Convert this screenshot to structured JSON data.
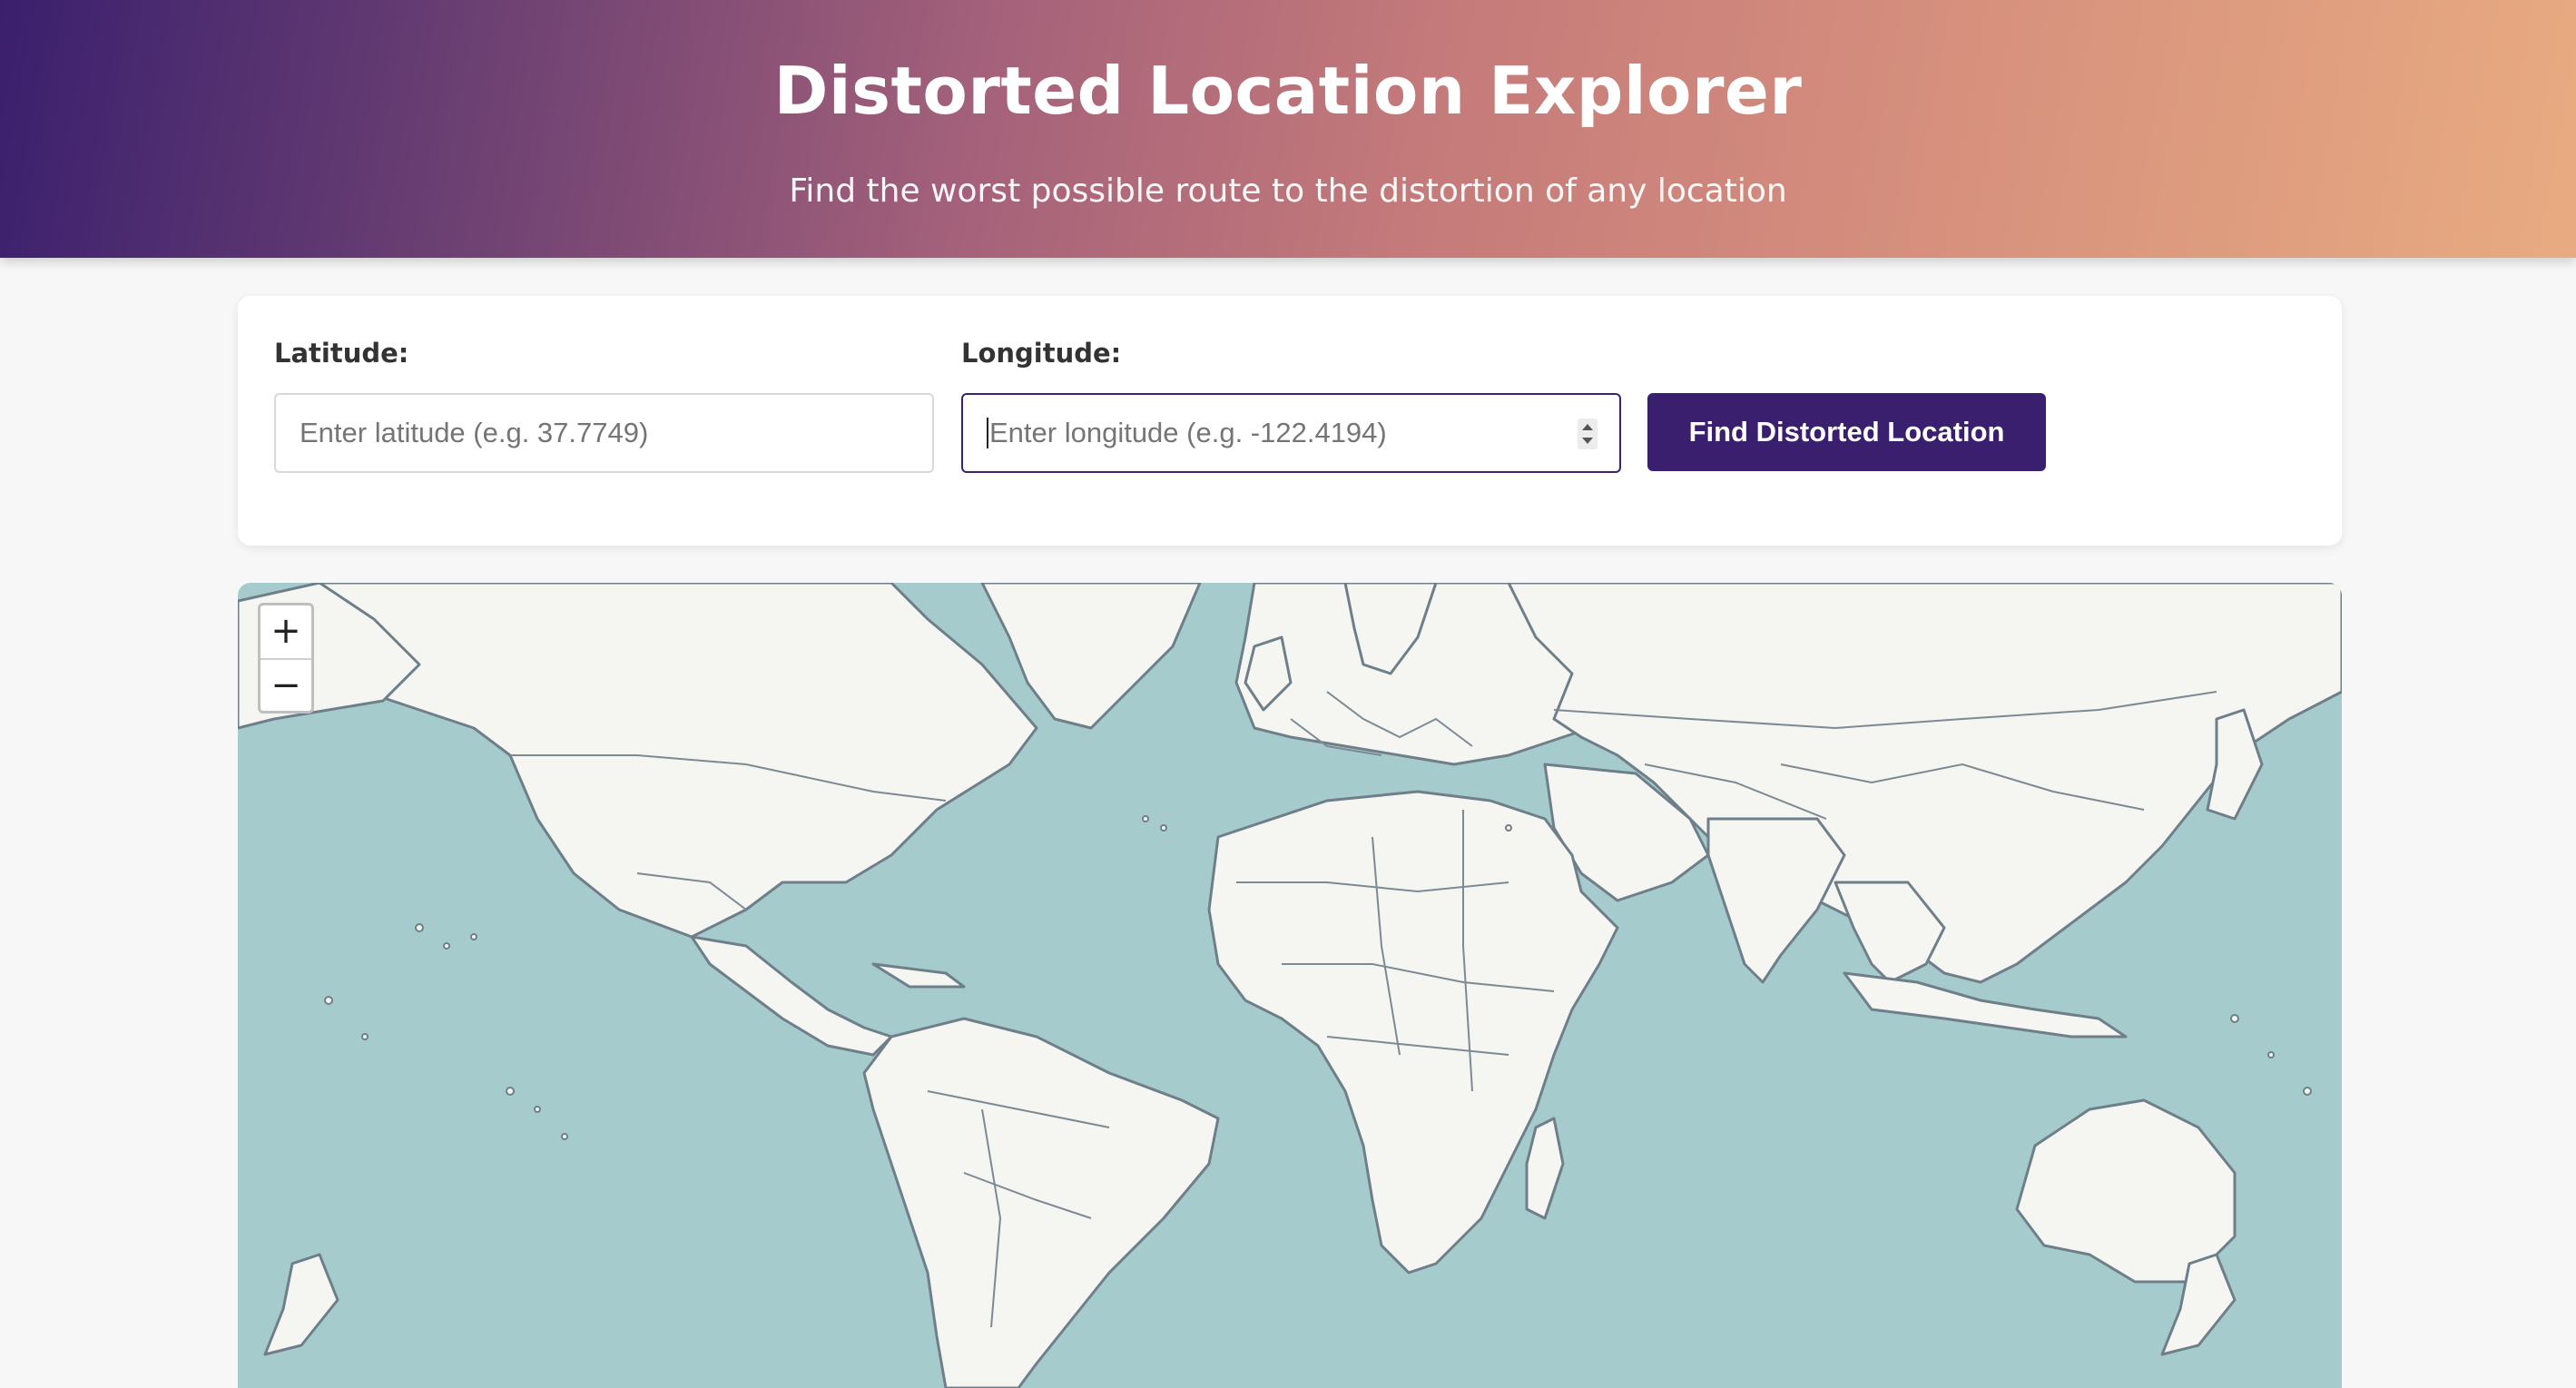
{
  "header": {
    "title": "Distorted Location Explorer",
    "subtitle": "Find the worst possible route to the distortion of any location"
  },
  "form": {
    "latitude_label": "Latitude:",
    "latitude_placeholder": "Enter latitude (e.g. 37.7749)",
    "longitude_label": "Longitude:",
    "longitude_placeholder": "Enter longitude (e.g. -122.4194)",
    "submit_label": "Find Distorted Location"
  },
  "map": {
    "zoom_in": "+",
    "zoom_out": "−",
    "colors": {
      "water": "#a6cbcc",
      "land": "#f5f5f2",
      "border": "#6f7f8a"
    },
    "view": "world"
  },
  "colors": {
    "brand": "#3a1f6e",
    "header_gradient_start": "#3a1f6e",
    "header_gradient_end": "#e8ab81"
  }
}
